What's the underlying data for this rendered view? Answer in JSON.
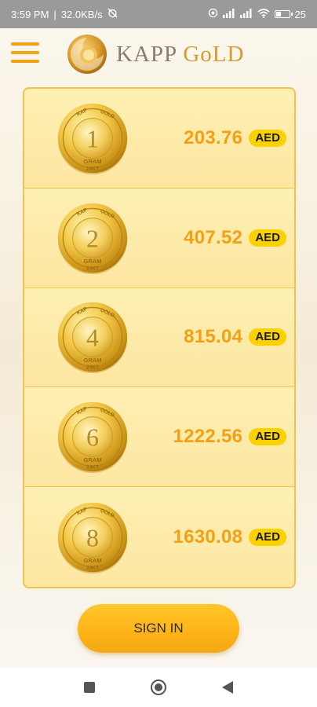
{
  "status_bar": {
    "time": "3:59 PM",
    "separator": "|",
    "speed": "32.0KB/s",
    "alarm_icon": "alarm-off-icon",
    "battery": "25"
  },
  "header": {
    "logo_text_1": "KAPP",
    "logo_text_2": "GoLD"
  },
  "coins": [
    {
      "weight": "1",
      "price": "203.76",
      "currency": "AED"
    },
    {
      "weight": "2",
      "price": "407.52",
      "currency": "AED"
    },
    {
      "weight": "4",
      "price": "815.04",
      "currency": "AED"
    },
    {
      "weight": "6",
      "price": "1222.56",
      "currency": "AED"
    },
    {
      "weight": "8",
      "price": "1630.08",
      "currency": "AED"
    }
  ],
  "coin_text": {
    "top_left": "KAP",
    "top_right": "GOLD",
    "unit": "GRAM",
    "purity": "24KT"
  },
  "signin_label": "SIGN IN",
  "colors": {
    "accent": "#f3a014",
    "badge": "#fbd100",
    "border": "#f0c34a"
  }
}
